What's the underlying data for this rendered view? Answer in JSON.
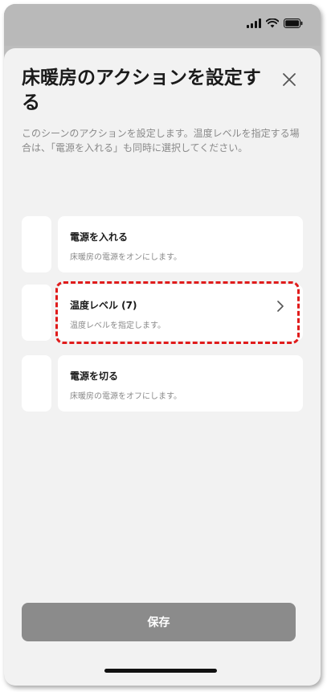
{
  "sheet": {
    "title": "床暖房のアクションを設定する",
    "description": "このシーンのアクションを設定します。温度レベルを指定する場合は、「電源を入れる」も同時に選択してください。"
  },
  "actions": [
    {
      "title": "電源を入れる",
      "description": "床暖房の電源をオンにします。"
    },
    {
      "title": "温度レベル (7)",
      "description": "温度レベルを指定します。",
      "icon": "chevron-right-icon"
    },
    {
      "title": "電源を切る",
      "description": "床暖房の電源をオフにします。"
    }
  ],
  "footer": {
    "save_label": "保存"
  },
  "colors": {
    "sheet_background": "#f2f2f2",
    "card_background": "#ffffff",
    "save_button": "#8b8b8b",
    "highlight": "#e01b1b"
  },
  "icons": [
    "signal-icon",
    "wifi-icon",
    "battery-icon",
    "close-icon",
    "chevron-right-icon"
  ]
}
